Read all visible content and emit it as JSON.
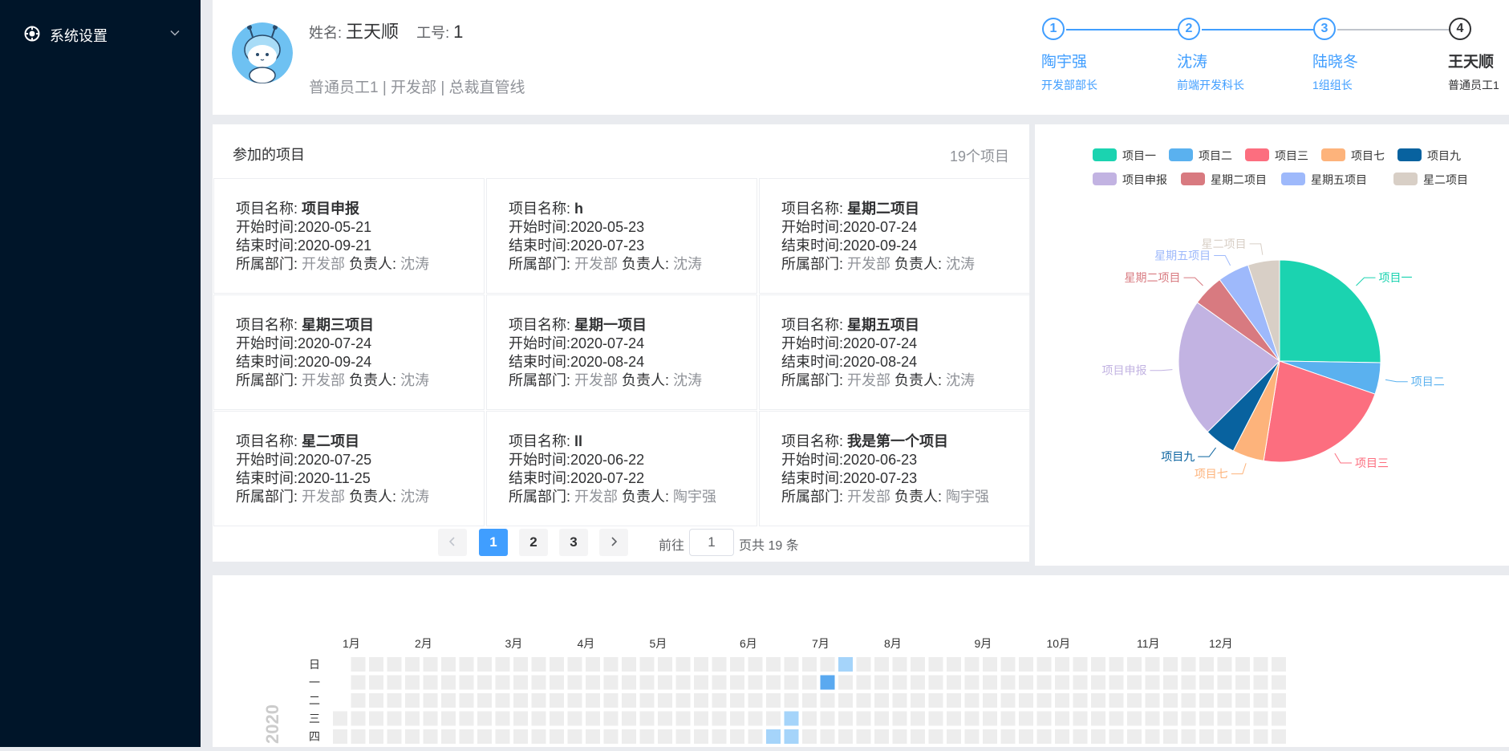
{
  "sidebar": {
    "menu": {
      "label": "系统设置",
      "icon": "settings-icon"
    }
  },
  "profile": {
    "name_label": "姓名:",
    "name": "王天顺",
    "id_label": "工号:",
    "id": "1",
    "dept_line": "普通员工1 | 开发部 | 总裁直管线",
    "steps": [
      {
        "num": "1",
        "title": "陶宇强",
        "desc": "开发部部长",
        "status": "done"
      },
      {
        "num": "2",
        "title": "沈涛",
        "desc": "前端开发科长",
        "status": "done"
      },
      {
        "num": "3",
        "title": "陆晓冬",
        "desc": "1组组长",
        "status": "done"
      },
      {
        "num": "4",
        "title": "王天顺",
        "desc": "普通员工1",
        "status": "current"
      }
    ]
  },
  "projects": {
    "header": "参加的项目",
    "count": "19个项目",
    "labels": {
      "name": "项目名称: ",
      "start": "开始时间:",
      "end": "结束时间:",
      "dept": "所属部门: ",
      "owner": " 负责人: "
    },
    "items": [
      {
        "name": "项目申报",
        "start": "2020-05-21",
        "end": "2020-09-21",
        "dept": "开发部",
        "owner": "沈涛"
      },
      {
        "name": "h",
        "start": "2020-05-23",
        "end": "2020-07-23",
        "dept": "开发部",
        "owner": "沈涛"
      },
      {
        "name": "星期二项目",
        "start": "2020-07-24",
        "end": "2020-09-24",
        "dept": "开发部",
        "owner": "沈涛"
      },
      {
        "name": "星期三项目",
        "start": "2020-07-24",
        "end": "2020-09-24",
        "dept": "开发部",
        "owner": "沈涛"
      },
      {
        "name": "星期一项目",
        "start": "2020-07-24",
        "end": "2020-08-24",
        "dept": "开发部",
        "owner": "沈涛"
      },
      {
        "name": "星期五项目",
        "start": "2020-07-24",
        "end": "2020-08-24",
        "dept": "开发部",
        "owner": "沈涛"
      },
      {
        "name": "星二项目",
        "start": "2020-07-25",
        "end": "2020-11-25",
        "dept": "开发部",
        "owner": "沈涛"
      },
      {
        "name": "ll",
        "start": "2020-06-22",
        "end": "2020-07-22",
        "dept": "开发部",
        "owner": "陶宇强"
      },
      {
        "name": "我是第一个项目",
        "start": "2020-06-23",
        "end": "2020-07-23",
        "dept": "开发部",
        "owner": "陶宇强"
      }
    ],
    "pagination": {
      "pages": [
        "1",
        "2",
        "3"
      ],
      "current": "1",
      "goto_label": "前往",
      "goto_value": "1",
      "total_label": "页共 19 条"
    }
  },
  "chart_data": [
    {
      "type": "pie",
      "legend_position": "top",
      "series": [
        {
          "name": "项目一",
          "value": 25,
          "color": "#1bd3b0"
        },
        {
          "name": "项目二",
          "value": 5,
          "color": "#5ab1ef"
        },
        {
          "name": "项目三",
          "value": 22,
          "color": "#fc6e7f"
        },
        {
          "name": "项目七",
          "value": 5,
          "color": "#fdb37b"
        },
        {
          "name": "项目九",
          "value": 5,
          "color": "#08629f"
        },
        {
          "name": "项目申报",
          "value": 22,
          "color": "#c2b3e2"
        },
        {
          "name": "星期二项目",
          "value": 5,
          "color": "#d87a80"
        },
        {
          "name": "星期五项目",
          "value": 5,
          "color": "#9eb9fb"
        },
        {
          "name": "星二项目",
          "value": 5,
          "color": "#d8cfc6"
        }
      ]
    },
    {
      "type": "heatmap",
      "year": "2020",
      "months": [
        "1月",
        "2月",
        "3月",
        "4月",
        "5月",
        "6月",
        "7月",
        "8月",
        "9月",
        "10月",
        "11月",
        "12月"
      ],
      "weekdays": [
        "日",
        "一",
        "二",
        "三",
        "四"
      ],
      "highlighted_days": [
        {
          "date": "2020-07-12",
          "level": 1
        },
        {
          "date": "2020-07-06",
          "level": 2
        },
        {
          "date": "2020-06-24",
          "level": 1
        },
        {
          "date": "2020-06-18",
          "level": 1
        },
        {
          "date": "2020-06-25",
          "level": 1
        }
      ],
      "colors": {
        "empty": "#ededed",
        "level1": "#a5d4fa",
        "level2": "#5aa9f0"
      }
    }
  ]
}
